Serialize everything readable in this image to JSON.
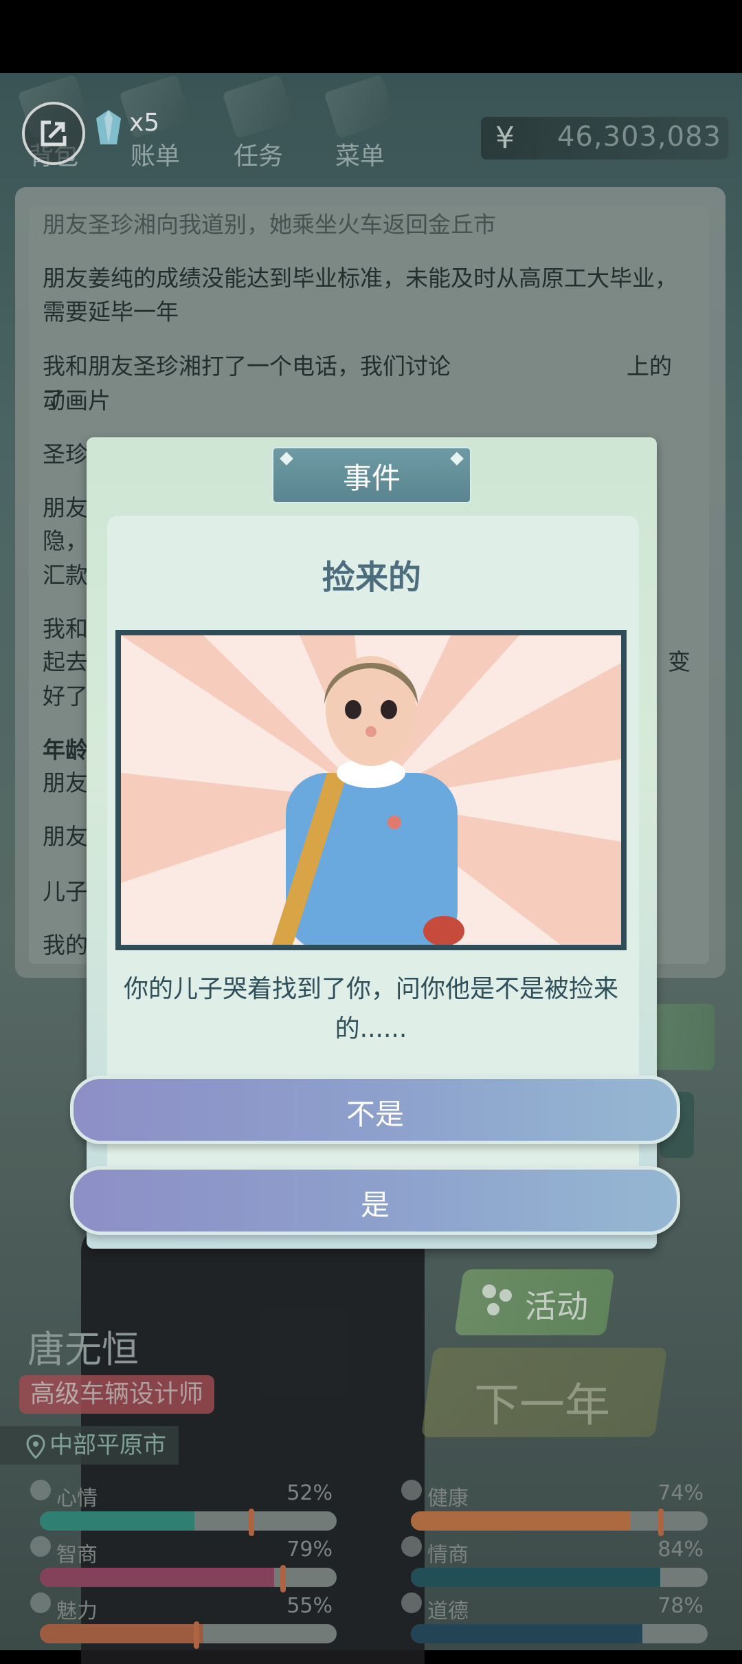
{
  "topbar": {
    "buttons": [
      {
        "label": "背包"
      },
      {
        "label": "账单"
      },
      {
        "label": "任务"
      },
      {
        "label": "菜单"
      }
    ],
    "gem_count": "x5",
    "money_symbol": "¥",
    "money": "46,303,083"
  },
  "log": {
    "entries": [
      "朋友圣珍湘向我道别，她乘坐火车返回金丘市",
      "朋友姜纯的成绩没能达到毕业标准，未能及时从高原工大毕业，需要延毕一年",
      "我和朋友圣珍湘打了一个电话，我们讨论了",
      "上的",
      "动画片",
      "圣珍湘",
      "朋友",
      "隐，",
      "汇款",
      "我和",
      "起去",
      "变",
      "好了",
      "年龄",
      "朋友",
      "朋友",
      "儿子",
      "我的"
    ]
  },
  "player": {
    "name": "唐无恒",
    "job": "高级车辆设计师",
    "city": "中部平原市"
  },
  "actions": {
    "activity": "活动",
    "next_year": "下一年"
  },
  "stats": [
    {
      "name": "心情",
      "pct": "52%",
      "value": 0.52,
      "color": "#2e8a7c",
      "icon": "smile-icon"
    },
    {
      "name": "健康",
      "pct": "74%",
      "value": 0.74,
      "color": "#c6703e",
      "icon": "heart-icon"
    },
    {
      "name": "智商",
      "pct": "79%",
      "value": 0.79,
      "color": "#93405c",
      "icon": "lightbulb-icon"
    },
    {
      "name": "情商",
      "pct": "84%",
      "value": 0.84,
      "color": "#1d4f57",
      "icon": "apple-icon"
    },
    {
      "name": "魅力",
      "pct": "55%",
      "value": 0.55,
      "color": "#b35f3c",
      "icon": "sparkle-icon"
    },
    {
      "name": "道德",
      "pct": "78%",
      "value": 0.78,
      "color": "#1d4257",
      "icon": "scales-icon"
    }
  ],
  "modal": {
    "tab": "事件",
    "title": "捡来的",
    "text": "你的儿子哭着找到了你，问你他是不是被捡来的......",
    "choices": [
      "不是",
      "是"
    ]
  }
}
